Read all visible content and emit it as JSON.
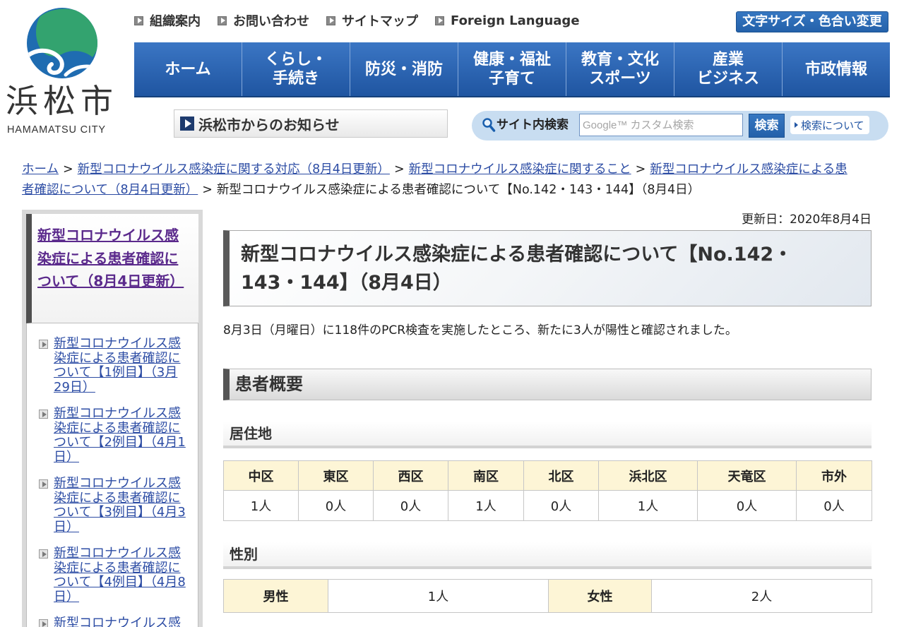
{
  "theme": {
    "nav_blue": "#1f55a1",
    "btn_blue": "#2461aa",
    "link": "#2c4ca4",
    "visited": "#5b2a8c",
    "th_bg": "#fdf5d6",
    "search_bg": "#c8ddf1",
    "logo_green": "#33a36f",
    "logo_blue": "#1f6cb1"
  },
  "header": {
    "logo_text": "浜松市",
    "logo_sub": "HAMAMATSU CITY",
    "top_links": [
      "組織案内",
      "お問い合わせ",
      "サイトマップ",
      "Foreign Language"
    ],
    "a11y_button": "文字サイズ・色合い変更"
  },
  "nav": {
    "items": [
      {
        "line1": "ホーム"
      },
      {
        "line1": "くらし・",
        "line2": "手続き"
      },
      {
        "line1": "防災・消防"
      },
      {
        "line1": "健康・福祉",
        "line2": "子育て"
      },
      {
        "line1": "教育・文化",
        "line2": "スポーツ"
      },
      {
        "line1": "産業",
        "line2": "ビジネス"
      },
      {
        "line1": "市政情報"
      }
    ]
  },
  "notice_link": "浜松市からのお知らせ",
  "search": {
    "label": "サイト内検索",
    "placeholder": "Google™ カスタム検索",
    "button": "検索",
    "about": "検索について"
  },
  "breadcrumb": {
    "separator": ">",
    "links": [
      "ホーム",
      "新型コロナウイルス感染症に関する対応（8月4日更新）",
      "新型コロナウイルス感染症に関すること",
      "新型コロナウイルス感染症による患者確認について（8月4日更新）"
    ],
    "current": "新型コロナウイルス感染症による患者確認について【No.142・143・144】（8月4日）"
  },
  "sidebar": {
    "heading": "新型コロナウイルス感染症による患者確認について（8月4日更新）",
    "items": [
      "新型コロナウイルス感染症による患者確認について【1例目】（3月29日）",
      "新型コロナウイルス感染症による患者確認について【2例目】（4月1日）",
      "新型コロナウイルス感染症による患者確認について【3例目】（4月3日）",
      "新型コロナウイルス感染症による患者確認について【4例目】（4月8日）",
      "新型コロナウイルス感"
    ]
  },
  "main": {
    "updated": "更新日：2020年8月4日",
    "title": "新型コロナウイルス感染症による患者確認について【No.142・143・144】（8月4日）",
    "intro": "8月3日（月曜日）に118件のPCR検査を実施したところ、新たに3人が陽性と確認されました。",
    "section_title": "患者概要",
    "residence": {
      "heading": "居住地",
      "columns": [
        "中区",
        "東区",
        "西区",
        "南区",
        "北区",
        "浜北区",
        "天竜区",
        "市外"
      ],
      "values": [
        "1人",
        "0人",
        "0人",
        "1人",
        "0人",
        "1人",
        "0人",
        "0人"
      ]
    },
    "gender": {
      "heading": "性別",
      "cells": [
        {
          "label": "男性",
          "value": "1人"
        },
        {
          "label": "女性",
          "value": "2人"
        }
      ]
    }
  }
}
